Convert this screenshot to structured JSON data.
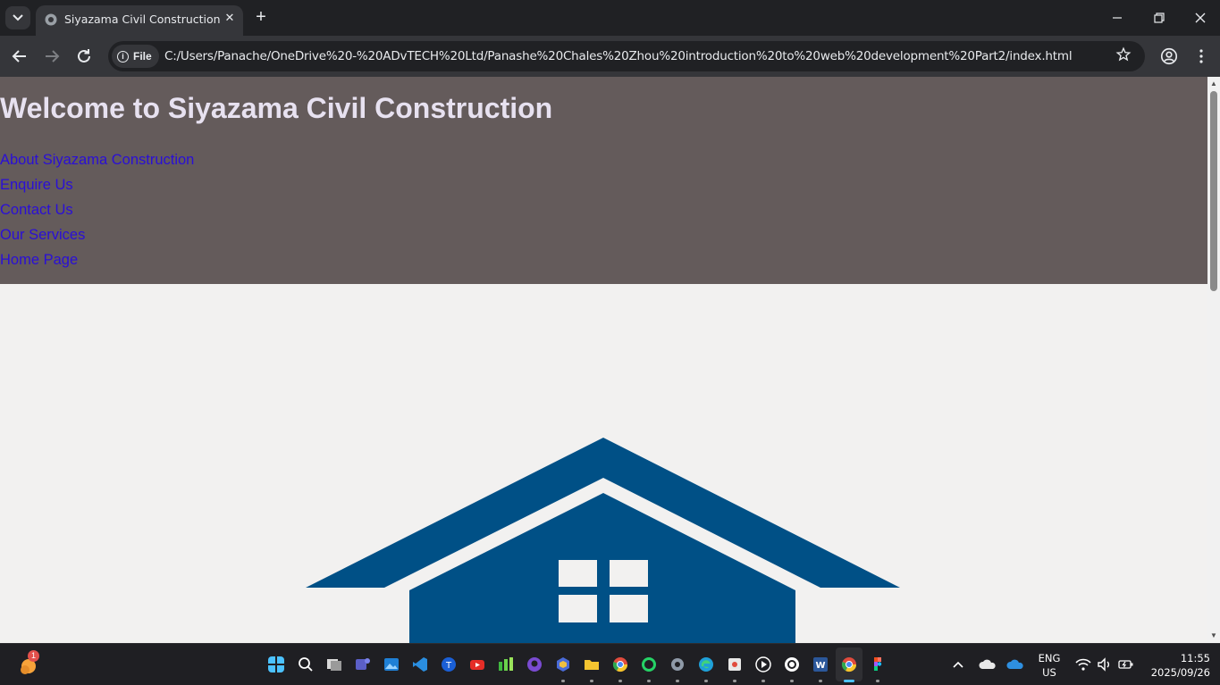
{
  "browser": {
    "tab_title": "Siyazama Civil Construction",
    "tab_close": "✕",
    "new_tab": "+",
    "chip_label": "File",
    "url": "C:/Users/Panache/OneDrive%20-%20ADvTECH%20Ltd/Panashe%20Chales%20Zhou%20introduction%20to%20web%20development%20Part2/index.html",
    "icons": [
      "tab-search-icon",
      "favicon-icon",
      "close-icon",
      "plus-icon",
      "minimize-icon",
      "restore-icon",
      "close-window-icon",
      "back-arrow-icon",
      "forward-arrow-icon",
      "reload-icon",
      "info-icon",
      "star-icon",
      "profile-icon",
      "kebab-menu-icon"
    ]
  },
  "page": {
    "title": "Welcome to Siyazama Civil Construction",
    "nav": [
      {
        "label": "About Siyazama Construction"
      },
      {
        "label": "Enquire Us"
      },
      {
        "label": "Contact Us"
      },
      {
        "label": "Our Services"
      },
      {
        "label": "Home Page"
      }
    ],
    "colors": {
      "header_bg": "#645b5b",
      "title": "#e7e1f0",
      "link": "#2a0fd6",
      "house": "#005086",
      "page_bg": "#f2f1f0"
    }
  },
  "taskbar": {
    "weather_badge": "1",
    "language_line1": "ENG",
    "language_line2": "US",
    "time": "11:55",
    "date": "2025/09/26"
  }
}
